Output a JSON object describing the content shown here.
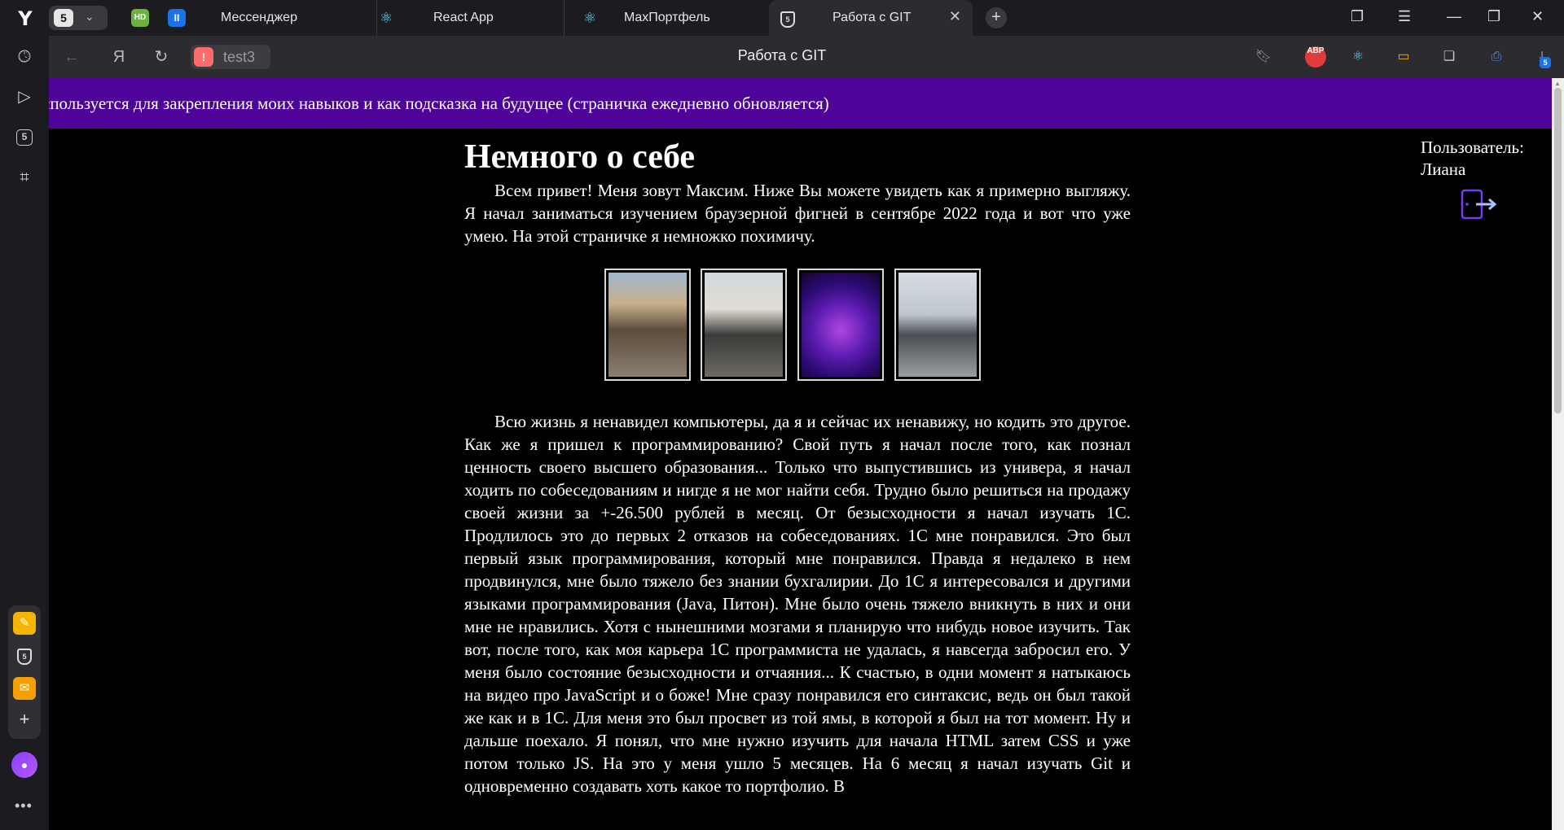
{
  "browser": {
    "app_logo": "Y",
    "tab_group_count": "5",
    "pinned": [
      {
        "label": "HD"
      },
      {
        "label": "II"
      }
    ],
    "tabs": [
      {
        "label": "Мессенджер",
        "icon": "messenger-icon"
      },
      {
        "label": "React App",
        "icon": "react-icon"
      },
      {
        "label": "MaxПортфель",
        "icon": "react-icon"
      },
      {
        "label": "Работа с GIT",
        "icon": "html5-icon",
        "active": true
      }
    ],
    "new_tab": "+",
    "address": {
      "site_label": "test3",
      "page_title": "Работа с GIT"
    },
    "extensions": {
      "abp_label": "ABP",
      "downloads_count": "5"
    },
    "sidebar": {
      "badge": "5"
    }
  },
  "page": {
    "marquee_text": "спользуется для закрепления моих навыков и как подсказка на будущее (страничка ежедневно обновляется)",
    "user": {
      "label": "Пользователь:",
      "name": "Лиана"
    },
    "article": {
      "title": "Немного о себе",
      "intro": "Всем привет! Меня зовут Максим. Ниже Вы можете увидеть как я примерно выгляжу. Я начал заниматься изучением браузерной фигней в сентябре 2022 года и вот что уже умею. На этой страничке я немножко похимичу.",
      "body": "Всю жизнь я ненавидел компьютеры, да я и сейчас их ненавижу, но кодить это другое. Как же я пришел к программированию? Свой путь я начал после того, как познал ценность своего высшего образования... Только что выпустившись из универа, я начал ходить по собеседованиям и нигде я не мог найти себя. Трудно было решиться на продажу своей жизни за +-26.500 рублей в месяц. От безысходности я начал изучать 1С. Продлилось это до первых 2 отказов на собеседованиях. 1С мне понравился. Это был первый язык программирования, который мне понравился. Правда я недалеко в нем продвинулся, мне было тяжело без знании бухгалирии. До 1С я интересовался и другими языками программирования (Java, Питон). Мне было очень тяжело вникнуть в них и они мне не нравились. Хотя с нынешними мозгами я планирую что нибудь новое изучить. Так вот, после того, как моя карьера 1С программиста не удалась, я навсегда забросил его. У меня было состояние безысходности и отчаяния... К счастью, в одни момент я натыкаюсь на видео про JavaScript и о боже! Мне сразу понравился его синтаксис, ведь он был такой же как и в 1С. Для меня это был просвет из той ямы, в которой я был на тот момент. Ну и дальше поехало. Я понял, что мне нужно изучить для начала HTML затем CSS и уже потом только JS. На это у меня ушло 5 месяцев. На 6 месяц я начал изучать Git и одновременно создавать хоть какое то портфолио. В"
    }
  },
  "colors": {
    "marquee_bg": "#4e0399",
    "page_bg": "#000000",
    "chrome_bg": "#1c1b1f",
    "toolbar_bg": "#2c2b30"
  }
}
